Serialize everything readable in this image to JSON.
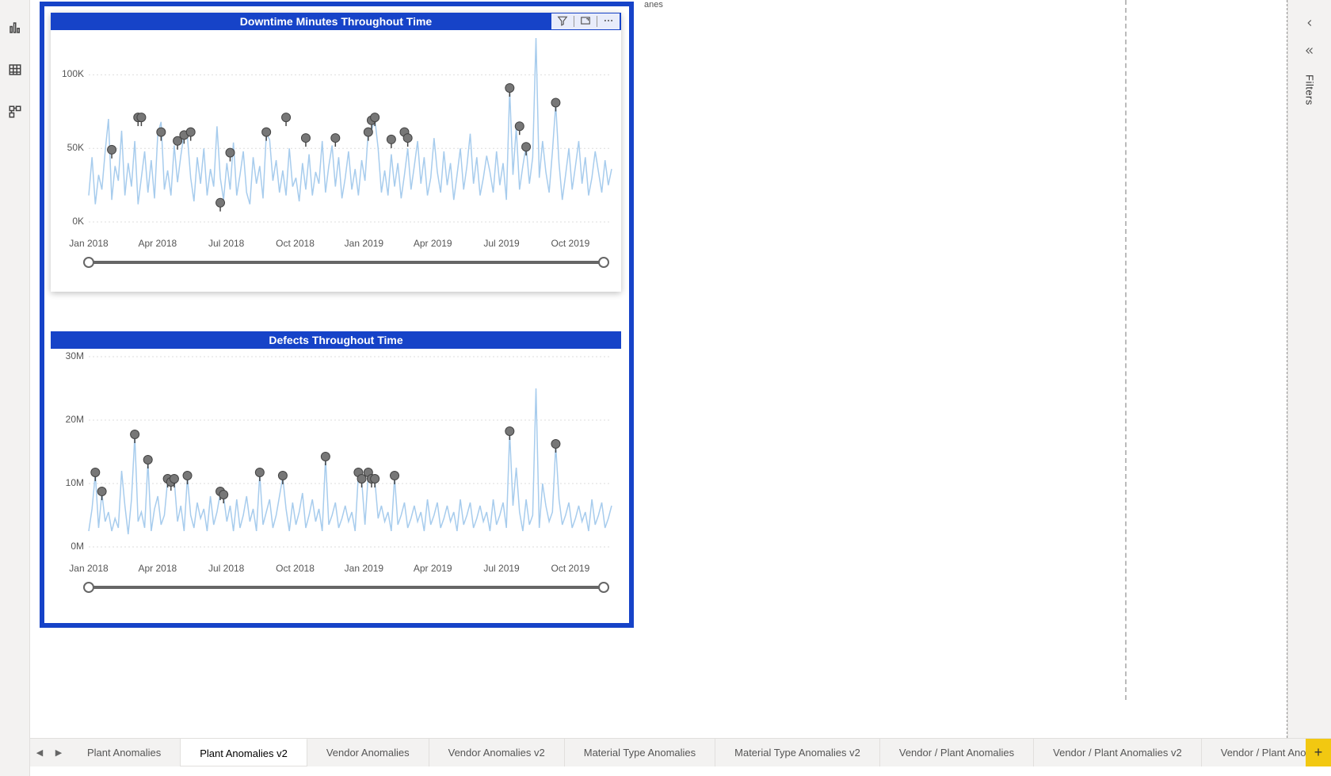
{
  "colors": {
    "accent": "#1643c8",
    "line": "#a7cced",
    "marker": "#777777",
    "brand_yellow": "#f2c811"
  },
  "left_rail": {
    "items": [
      {
        "name": "report-view-icon"
      },
      {
        "name": "data-view-icon"
      },
      {
        "name": "model-view-icon"
      }
    ]
  },
  "right_panel": {
    "label": "Filters"
  },
  "truncated_watermark": "anes",
  "tabs": {
    "items": [
      {
        "label": "Plant Anomalies",
        "active": false
      },
      {
        "label": "Plant Anomalies v2",
        "active": true
      },
      {
        "label": "Vendor Anomalies",
        "active": false
      },
      {
        "label": "Vendor Anomalies v2",
        "active": false
      },
      {
        "label": "Material Type Anomalies",
        "active": false
      },
      {
        "label": "Material Type Anomalies v2",
        "active": false
      },
      {
        "label": "Vendor / Plant Anomalies",
        "active": false
      },
      {
        "label": "Vendor / Plant Anomalies v2",
        "active": false
      },
      {
        "label": "Vendor / Plant Ano",
        "active": false
      }
    ]
  },
  "chart_data": [
    {
      "type": "line",
      "title": "Downtime Minutes Throughout Time",
      "xlabel": "",
      "ylabel": "",
      "ylim": [
        0,
        125000
      ],
      "y_ticks": [
        {
          "v": 0,
          "label": "0K"
        },
        {
          "v": 50000,
          "label": "50K"
        },
        {
          "v": 100000,
          "label": "100K"
        }
      ],
      "x_ticks": [
        "Jan 2018",
        "Apr 2018",
        "Jul 2018",
        "Oct 2018",
        "Jan 2019",
        "Apr 2019",
        "Jul 2019",
        "Oct 2019"
      ],
      "series": [
        {
          "name": "Downtime Minutes",
          "values": [
            18000,
            44000,
            12000,
            32000,
            22000,
            48000,
            70000,
            15000,
            38000,
            28000,
            62000,
            18000,
            40000,
            24000,
            55000,
            12000,
            30000,
            48000,
            20000,
            42000,
            16000,
            60000,
            68000,
            22000,
            35000,
            18000,
            52000,
            27000,
            45000,
            60000,
            58000,
            30000,
            14000,
            44000,
            26000,
            50000,
            18000,
            36000,
            24000,
            65000,
            30000,
            15000,
            40000,
            22000,
            54000,
            18000,
            32000,
            48000,
            20000,
            12000,
            44000,
            26000,
            38000,
            16000,
            60000,
            56000,
            28000,
            42000,
            20000,
            35000,
            18000,
            50000,
            24000,
            30000,
            14000,
            40000,
            22000,
            46000,
            18000,
            34000,
            26000,
            55000,
            20000,
            38000,
            52000,
            24000,
            44000,
            16000,
            30000,
            48000,
            22000,
            36000,
            18000,
            42000,
            28000,
            62000,
            62000,
            70000,
            50000,
            20000,
            35000,
            18000,
            46000,
            24000,
            40000,
            16000,
            32000,
            50000,
            22000,
            38000,
            55000,
            26000,
            44000,
            18000,
            30000,
            57000,
            34000,
            20000,
            48000,
            25000,
            40000,
            15000,
            32000,
            50000,
            22000,
            38000,
            60000,
            26000,
            44000,
            18000,
            30000,
            45000,
            34000,
            20000,
            48000,
            25000,
            40000,
            15000,
            90000,
            32000,
            64000,
            22000,
            38000,
            52000,
            26000,
            44000,
            125000,
            30000,
            55000,
            34000,
            20000,
            48000,
            80000,
            40000,
            15000,
            32000,
            50000,
            22000,
            38000,
            55000,
            26000,
            44000,
            18000,
            30000,
            48000,
            34000,
            20000,
            42000,
            25000,
            36000
          ]
        }
      ],
      "anomalies": [
        {
          "i": 7,
          "v": 48000
        },
        {
          "i": 15,
          "v": 70000
        },
        {
          "i": 16,
          "v": 70000
        },
        {
          "i": 22,
          "v": 60000
        },
        {
          "i": 27,
          "v": 54000
        },
        {
          "i": 29,
          "v": 58000
        },
        {
          "i": 31,
          "v": 60000
        },
        {
          "i": 40,
          "v": 12000
        },
        {
          "i": 43,
          "v": 46000
        },
        {
          "i": 54,
          "v": 60000
        },
        {
          "i": 60,
          "v": 70000
        },
        {
          "i": 66,
          "v": 56000
        },
        {
          "i": 75,
          "v": 56000
        },
        {
          "i": 85,
          "v": 60000
        },
        {
          "i": 86,
          "v": 68000
        },
        {
          "i": 87,
          "v": 70000
        },
        {
          "i": 92,
          "v": 55000
        },
        {
          "i": 96,
          "v": 60000
        },
        {
          "i": 97,
          "v": 56000
        },
        {
          "i": 128,
          "v": 90000
        },
        {
          "i": 131,
          "v": 64000
        },
        {
          "i": 133,
          "v": 50000
        },
        {
          "i": 142,
          "v": 80000
        }
      ]
    },
    {
      "type": "line",
      "title": "Defects Throughout Time",
      "xlabel": "",
      "ylabel": "",
      "ylim": [
        0,
        30000000
      ],
      "y_ticks": [
        {
          "v": 0,
          "label": "0M"
        },
        {
          "v": 10000000,
          "label": "10M"
        },
        {
          "v": 20000000,
          "label": "20M"
        },
        {
          "v": 30000000,
          "label": "30M"
        }
      ],
      "x_ticks": [
        "Jan 2018",
        "Apr 2018",
        "Jul 2018",
        "Oct 2018",
        "Jan 2019",
        "Apr 2019",
        "Jul 2019",
        "Oct 2019"
      ],
      "series": [
        {
          "name": "Defects",
          "values": [
            2500000,
            6000000,
            11500000,
            3000000,
            8500000,
            4000000,
            5500000,
            2500000,
            4500000,
            3000000,
            12000000,
            6500000,
            2000000,
            7500000,
            17500000,
            4000000,
            5500000,
            3000000,
            13500000,
            2500000,
            6000000,
            8000000,
            3500000,
            5000000,
            10500000,
            10000000,
            10500000,
            4000000,
            6500000,
            2500000,
            11000000,
            5000000,
            3000000,
            7000000,
            4500000,
            6000000,
            2500000,
            8000000,
            3500000,
            5500000,
            8500000,
            8000000,
            4000000,
            6500000,
            2500000,
            7500000,
            3000000,
            5000000,
            8000000,
            4000000,
            6000000,
            2500000,
            11500000,
            3500000,
            5500000,
            7500000,
            3000000,
            5000000,
            8000000,
            11000000,
            6000000,
            2500000,
            7000000,
            3500000,
            5500000,
            8500000,
            3000000,
            5000000,
            7500000,
            4000000,
            6000000,
            2500000,
            14000000,
            3500000,
            5000000,
            7000000,
            3000000,
            4500000,
            6500000,
            4000000,
            5500000,
            2500000,
            11500000,
            10500000,
            3500000,
            11500000,
            10500000,
            10500000,
            4500000,
            6500000,
            4000000,
            5500000,
            2500000,
            11000000,
            3500000,
            5000000,
            7000000,
            3000000,
            4500000,
            6500000,
            4000000,
            5500000,
            2500000,
            7500000,
            3500000,
            5000000,
            7000000,
            3000000,
            4500000,
            6500000,
            4000000,
            5500000,
            2500000,
            7500000,
            3500000,
            5000000,
            7000000,
            3000000,
            4500000,
            6500000,
            4000000,
            5500000,
            2500000,
            7500000,
            3500000,
            5000000,
            7000000,
            3000000,
            18000000,
            6500000,
            12500000,
            5500000,
            2500000,
            7500000,
            3500000,
            5000000,
            25000000,
            3000000,
            10000000,
            6500000,
            4000000,
            5500000,
            16000000,
            7500000,
            3500000,
            5000000,
            7000000,
            3000000,
            4500000,
            6500000,
            4000000,
            5500000,
            2500000,
            7500000,
            3500000,
            5000000,
            7000000,
            3000000,
            4500000,
            6500000
          ]
        }
      ],
      "anomalies": [
        {
          "i": 2,
          "v": 11500000
        },
        {
          "i": 4,
          "v": 8500000
        },
        {
          "i": 14,
          "v": 17500000
        },
        {
          "i": 18,
          "v": 13500000
        },
        {
          "i": 24,
          "v": 10500000
        },
        {
          "i": 25,
          "v": 10000000
        },
        {
          "i": 26,
          "v": 10500000
        },
        {
          "i": 30,
          "v": 11000000
        },
        {
          "i": 40,
          "v": 8500000
        },
        {
          "i": 41,
          "v": 8000000
        },
        {
          "i": 52,
          "v": 11500000
        },
        {
          "i": 59,
          "v": 11000000
        },
        {
          "i": 72,
          "v": 14000000
        },
        {
          "i": 82,
          "v": 11500000
        },
        {
          "i": 83,
          "v": 10500000
        },
        {
          "i": 85,
          "v": 11500000
        },
        {
          "i": 86,
          "v": 10500000
        },
        {
          "i": 87,
          "v": 10500000
        },
        {
          "i": 93,
          "v": 11000000
        },
        {
          "i": 128,
          "v": 18000000
        },
        {
          "i": 142,
          "v": 16000000
        }
      ]
    }
  ]
}
